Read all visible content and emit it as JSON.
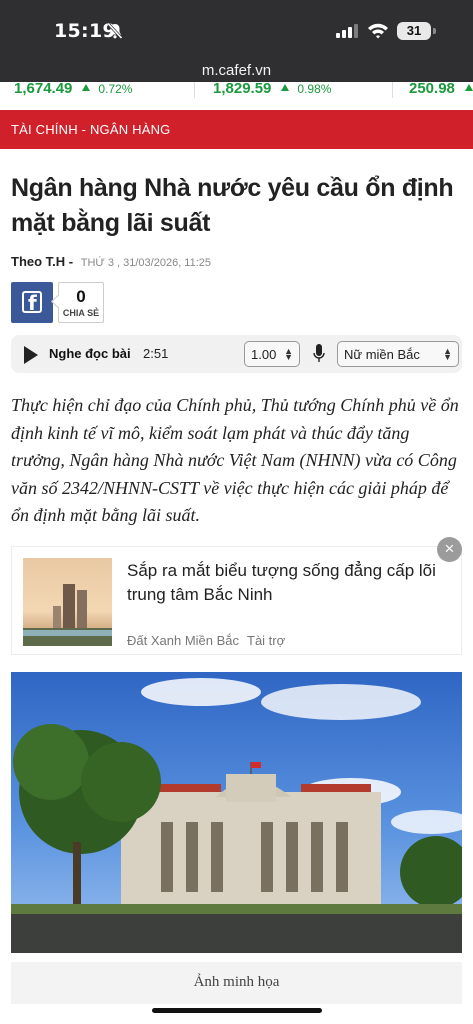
{
  "status_bar": {
    "time": "15:19",
    "battery": "31"
  },
  "browser": {
    "url": "m.cafef.vn"
  },
  "ticker": [
    {
      "value": "1,674.49",
      "change": "0.72%"
    },
    {
      "value": "1,829.59",
      "change": "0.98%"
    },
    {
      "value": "250.98",
      "change": ""
    }
  ],
  "category": "TÀI CHÍNH - NGÂN HÀNG",
  "article": {
    "title": "Ngân hàng Nhà nước yêu cầu ổn định mặt bằng lãi suất",
    "author": "Theo T.H -",
    "date": "THỨ 3 , 31/03/2026, 11:25",
    "lead": "Thực hiện chỉ đạo của Chính phủ, Thủ tướng Chính phủ về ổn định kinh tế vĩ mô, kiểm soát lạm phát và thúc đẩy tăng trưởng, Ngân hàng Nhà nước Việt Nam (NHNN) vừa có Công văn số 2342/NHNN-CSTT về việc thực hiện các giải pháp để ổn định mặt bằng lãi suất.",
    "image_caption": "Ảnh minh họa"
  },
  "share": {
    "count": "0",
    "label": "CHIA SẺ"
  },
  "player": {
    "label": "Nghe đọc bài",
    "duration": "2:51",
    "speed": "1.00",
    "voice": "Nữ miền Bắc"
  },
  "ad": {
    "title": "Sắp ra mắt biểu tượng sống đẳng cấp lõi trung tâm Bắc Ninh",
    "advertiser": "Đất Xanh Miền Bắc",
    "sponsored": "Tài trợ",
    "close": "×"
  },
  "colors": {
    "brand_red": "#d0202a",
    "up_green": "#1a9a3c",
    "facebook": "#3b5998"
  },
  "icons": {
    "mute": "bell-slash-icon",
    "signal": "cellular-signal-icon",
    "wifi": "wifi-icon",
    "play": "play-icon",
    "mic": "microphone-icon",
    "facebook": "facebook-icon",
    "close": "close-icon"
  }
}
